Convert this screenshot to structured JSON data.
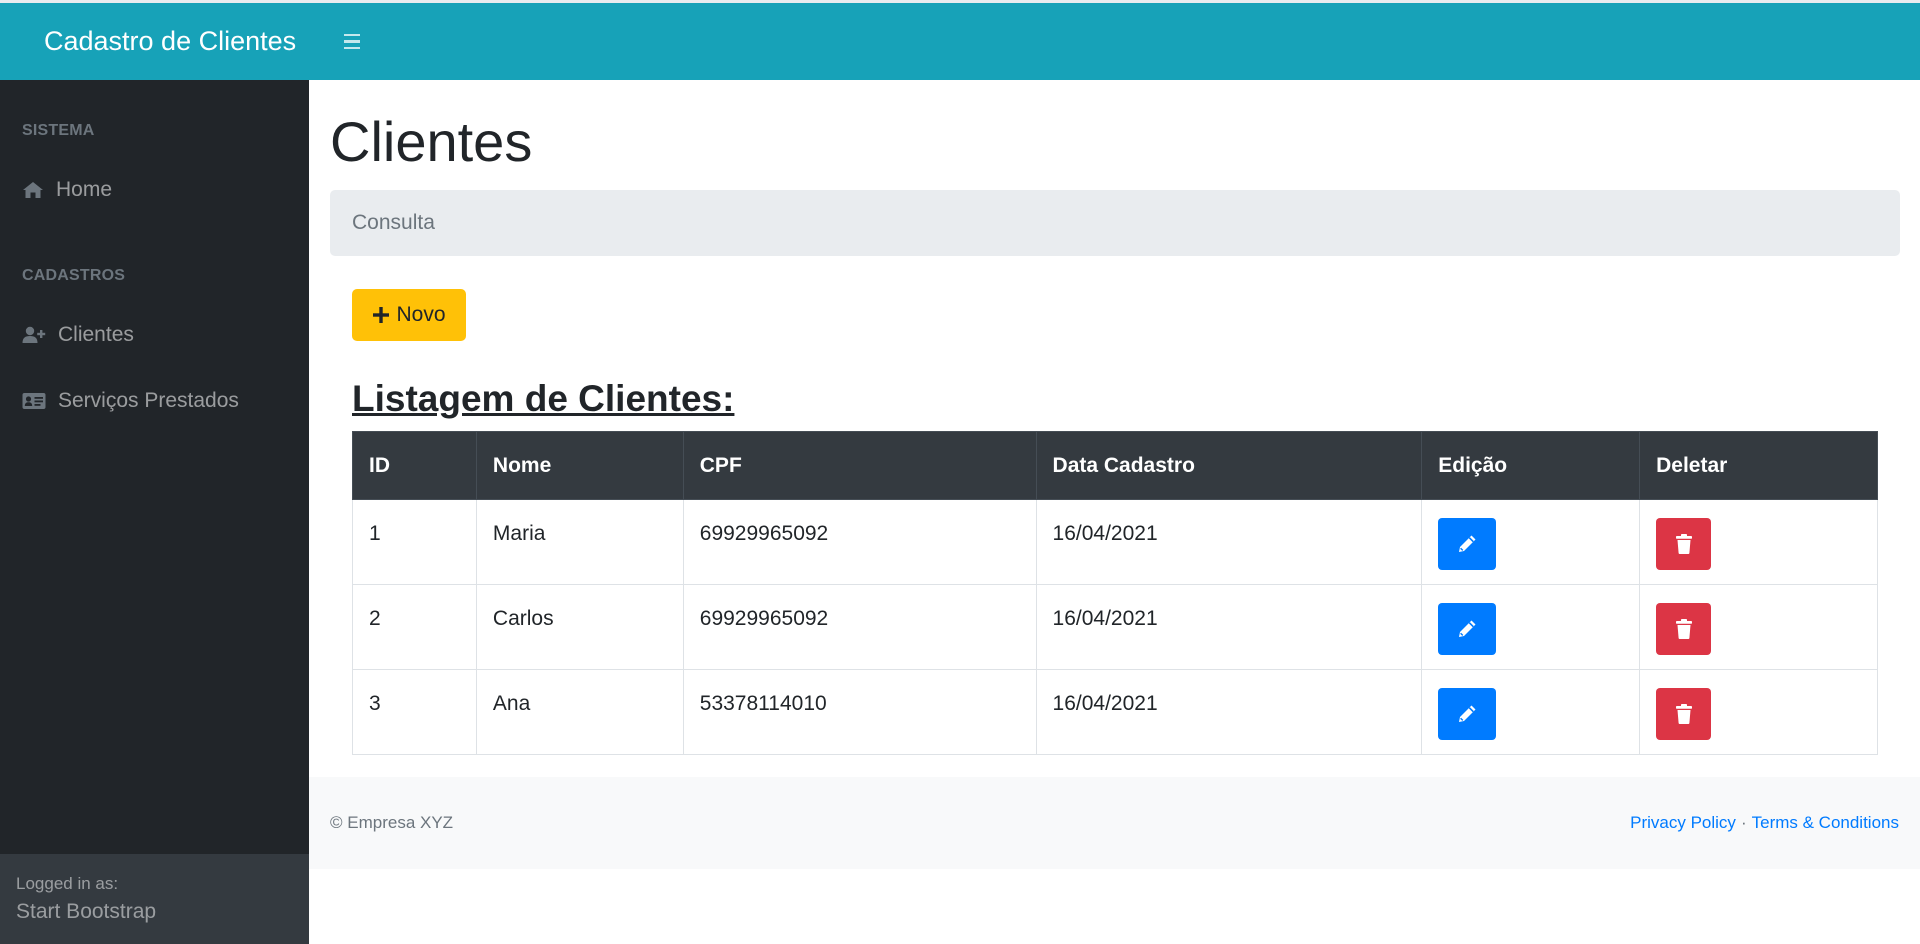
{
  "navbar": {
    "brand": "Cadastro de Clientes"
  },
  "sidebar": {
    "section_system": "SISTEMA",
    "home_label": "Home",
    "section_registers": "CADASTROS",
    "clients_label": "Clientes",
    "services_label": "Serviços Prestados",
    "footer_small": "Logged in as:",
    "footer_user": "Start Bootstrap"
  },
  "main": {
    "title": "Clientes",
    "breadcrumb": "Consulta",
    "new_button": "Novo",
    "list_title": "Listagem de Clientes:"
  },
  "table": {
    "headers": [
      "ID",
      "Nome",
      "CPF",
      "Data Cadastro",
      "Edição",
      "Deletar"
    ],
    "rows": [
      {
        "id": "1",
        "nome": "Maria",
        "cpf": "69929965092",
        "data": "16/04/2021"
      },
      {
        "id": "2",
        "nome": "Carlos",
        "cpf": "69929965092",
        "data": "16/04/2021"
      },
      {
        "id": "3",
        "nome": "Ana",
        "cpf": "53378114010",
        "data": "16/04/2021"
      }
    ]
  },
  "footer": {
    "copyright": "© Empresa XYZ",
    "privacy": "Privacy Policy",
    "separator": "·",
    "terms": "Terms & Conditions"
  },
  "colors": {
    "navbar": "#17a2b8",
    "sidebar": "#212529",
    "warning": "#ffc107",
    "primary": "#007bff",
    "danger": "#dc3545"
  },
  "icons": {
    "menu": "bars-icon",
    "home": "home-icon",
    "clients": "user-plus-icon",
    "services": "id-card-icon",
    "new": "plus-icon",
    "edit": "pencil-icon",
    "delete": "trash-icon"
  }
}
